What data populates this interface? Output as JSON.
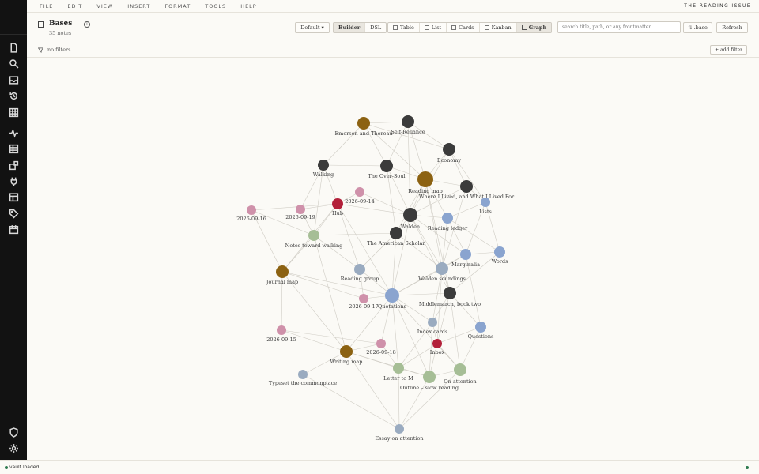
{
  "menubar": {
    "items": [
      "FILE",
      "EDIT",
      "VIEW",
      "INSERT",
      "FORMAT",
      "TOOLS",
      "HELP"
    ],
    "brand": "THE READING ISSUE"
  },
  "header": {
    "title": "Bases",
    "subtitle": "35 notes",
    "default_label": "Default ▾",
    "mode_tabs": [
      "Builder",
      "DSL"
    ],
    "view_tabs": [
      "Table",
      "List",
      "Cards",
      "Kanban",
      "Graph"
    ],
    "active_view": "Graph",
    "search_placeholder": "search title, path, or any frontmatter…",
    "base_label": "⇅ .base",
    "refresh_label": "Refresh"
  },
  "filterbar": {
    "text": "no filters",
    "add_label": "+ add filter"
  },
  "graph": {
    "colors": {
      "dark": "#3b3b3b",
      "gold": "#8c6212",
      "pink": "#cf91aa",
      "blue": "#8aa4cf",
      "sage": "#a6be96",
      "red": "#b3203a",
      "slate": "#9aabc0"
    },
    "nodes": [
      {
        "id": "emerson",
        "label": "Emerson and Thoreau",
        "kind": "gold"
      },
      {
        "id": "selfreliance",
        "label": "Self-Reliance",
        "kind": "dark"
      },
      {
        "id": "economy",
        "label": "Economy",
        "kind": "dark"
      },
      {
        "id": "walking",
        "label": "Walking",
        "kind": "dark"
      },
      {
        "id": "oversoul",
        "label": "The Over-Soul",
        "kind": "dark"
      },
      {
        "id": "readingmap",
        "label": "Reading map",
        "kind": "gold"
      },
      {
        "id": "wherelived",
        "label": "Where I Lived, and What I Lived For",
        "kind": "dark"
      },
      {
        "id": "d0914",
        "label": "2026-09-14",
        "kind": "pink"
      },
      {
        "id": "hub",
        "label": "Hub",
        "kind": "red"
      },
      {
        "id": "lists",
        "label": "Lists",
        "kind": "blue"
      },
      {
        "id": "d0916",
        "label": "2026-09-16",
        "kind": "pink"
      },
      {
        "id": "d0919",
        "label": "2026-09-19",
        "kind": "pink"
      },
      {
        "id": "walden",
        "label": "Walden",
        "kind": "dark"
      },
      {
        "id": "ledger",
        "label": "Reading ledger",
        "kind": "blue"
      },
      {
        "id": "notesww",
        "label": "Notes toward walking",
        "kind": "sage"
      },
      {
        "id": "amscholar",
        "label": "The American Scholar",
        "kind": "dark"
      },
      {
        "id": "marginalia",
        "label": "Marginalia",
        "kind": "blue"
      },
      {
        "id": "words",
        "label": "Words",
        "kind": "blue"
      },
      {
        "id": "journalmap",
        "label": "Journal map",
        "kind": "gold"
      },
      {
        "id": "readgroup",
        "label": "Reading group",
        "kind": "slate"
      },
      {
        "id": "soundings",
        "label": "Walden soundings",
        "kind": "slate"
      },
      {
        "id": "d0917",
        "label": "2026-09-17",
        "kind": "pink"
      },
      {
        "id": "quotations",
        "label": "Quotations",
        "kind": "blue"
      },
      {
        "id": "middlemarch",
        "label": "Middlemarch, book two",
        "kind": "dark"
      },
      {
        "id": "indexcards",
        "label": "Index cards",
        "kind": "slate"
      },
      {
        "id": "questions",
        "label": "Questions",
        "kind": "blue"
      },
      {
        "id": "d0915",
        "label": "2026-09-15",
        "kind": "pink"
      },
      {
        "id": "inbox",
        "label": "Inbox",
        "kind": "red"
      },
      {
        "id": "d0918",
        "label": "2026-09-18",
        "kind": "pink"
      },
      {
        "id": "writingmap",
        "label": "Writing map",
        "kind": "gold"
      },
      {
        "id": "letterm",
        "label": "Letter to M",
        "kind": "sage"
      },
      {
        "id": "onattention",
        "label": "On attention",
        "kind": "sage"
      },
      {
        "id": "outline",
        "label": "Outline – slow reading",
        "kind": "sage"
      },
      {
        "id": "typeset",
        "label": "Typeset the commonplace",
        "kind": "slate"
      },
      {
        "id": "essay",
        "label": "Essay on attention",
        "kind": "slate"
      }
    ]
  },
  "status": {
    "text": "vault loaded"
  }
}
